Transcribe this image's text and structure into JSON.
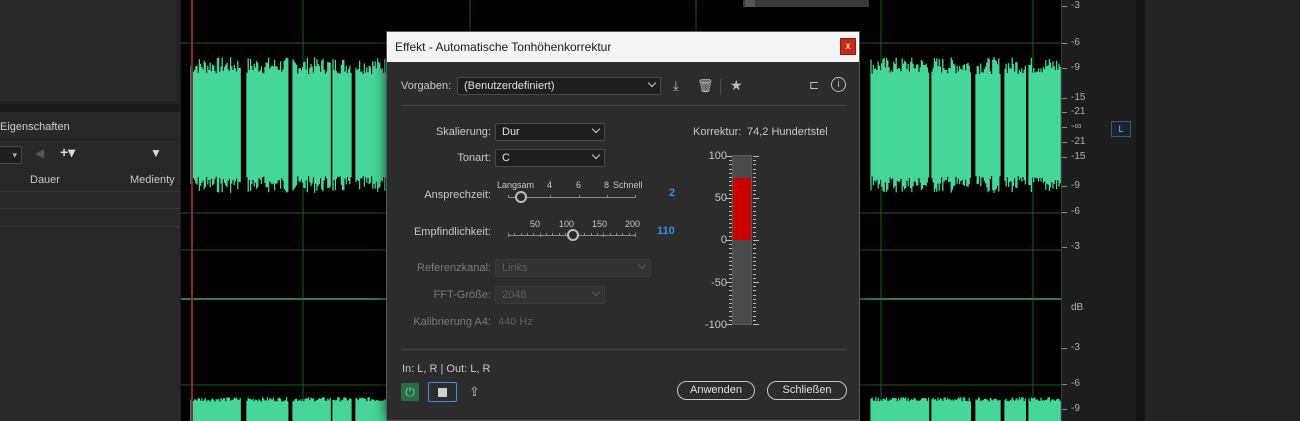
{
  "left_panel": {
    "properties_title": "Eigenschaften",
    "columns": {
      "duration": "Dauer",
      "media_type": "Medienty"
    },
    "icons": {
      "back": "arrow-left-icon",
      "add": "plus-dropdown-icon",
      "filter": "filter-icon"
    }
  },
  "waveform": {
    "color": "#47d69a",
    "grid_color": "#1f5a1f",
    "playhead_color": "#8a2a2a"
  },
  "db_ruler": {
    "top_labels": [
      "-3",
      "-6",
      "-9",
      "-15",
      "-21",
      "-∞",
      "-21",
      "-15",
      "-9",
      "-6",
      "-3"
    ],
    "bottom_labels": [
      "dB",
      "-3",
      "-6",
      "-9"
    ],
    "channel_badge": "L"
  },
  "dialog": {
    "title": "Effekt - Automatische Tonhöhenkorrektur",
    "close_label": "x",
    "presets_label": "Vorgaben:",
    "presets_value": "(Benutzerdefiniert)",
    "toolbar_icons": [
      "download-icon",
      "trash-icon",
      "star-icon",
      "routing-icon",
      "info-icon"
    ],
    "scale_label": "Skalierung:",
    "scale_value": "Dur",
    "key_label": "Tonart:",
    "key_value": "C",
    "attack_label": "Ansprechzeit:",
    "attack_scale": {
      "min_label": "Langsam",
      "ticks": [
        "4",
        "6",
        "8"
      ],
      "max_label": "Schnell"
    },
    "attack_value": "2",
    "sensitivity_label": "Empfindlichkeit:",
    "sensitivity_scale": [
      "50",
      "100",
      "150",
      "200"
    ],
    "sensitivity_value": "110",
    "ref_channel_label": "Referenzkanal:",
    "ref_channel_value": "Links",
    "fft_label": "FFT-Größe:",
    "fft_value": "2048",
    "calibration_label": "Kalibrierung A4:",
    "calibration_value": "440 Hz",
    "correction_label": "Korrektur:",
    "correction_value": "74,2 Hundertstel",
    "meter_labels": [
      "100",
      "50",
      "0",
      "-50",
      "-100"
    ],
    "meter_range": [
      -100,
      100
    ],
    "meter_fill": [
      0,
      74.2
    ],
    "io_text": "In: L, R | Out: L, R",
    "apply_button": "Anwenden",
    "close_button": "Schließen",
    "accent_color": "#3b8de0",
    "meter_color": "#c80000"
  }
}
